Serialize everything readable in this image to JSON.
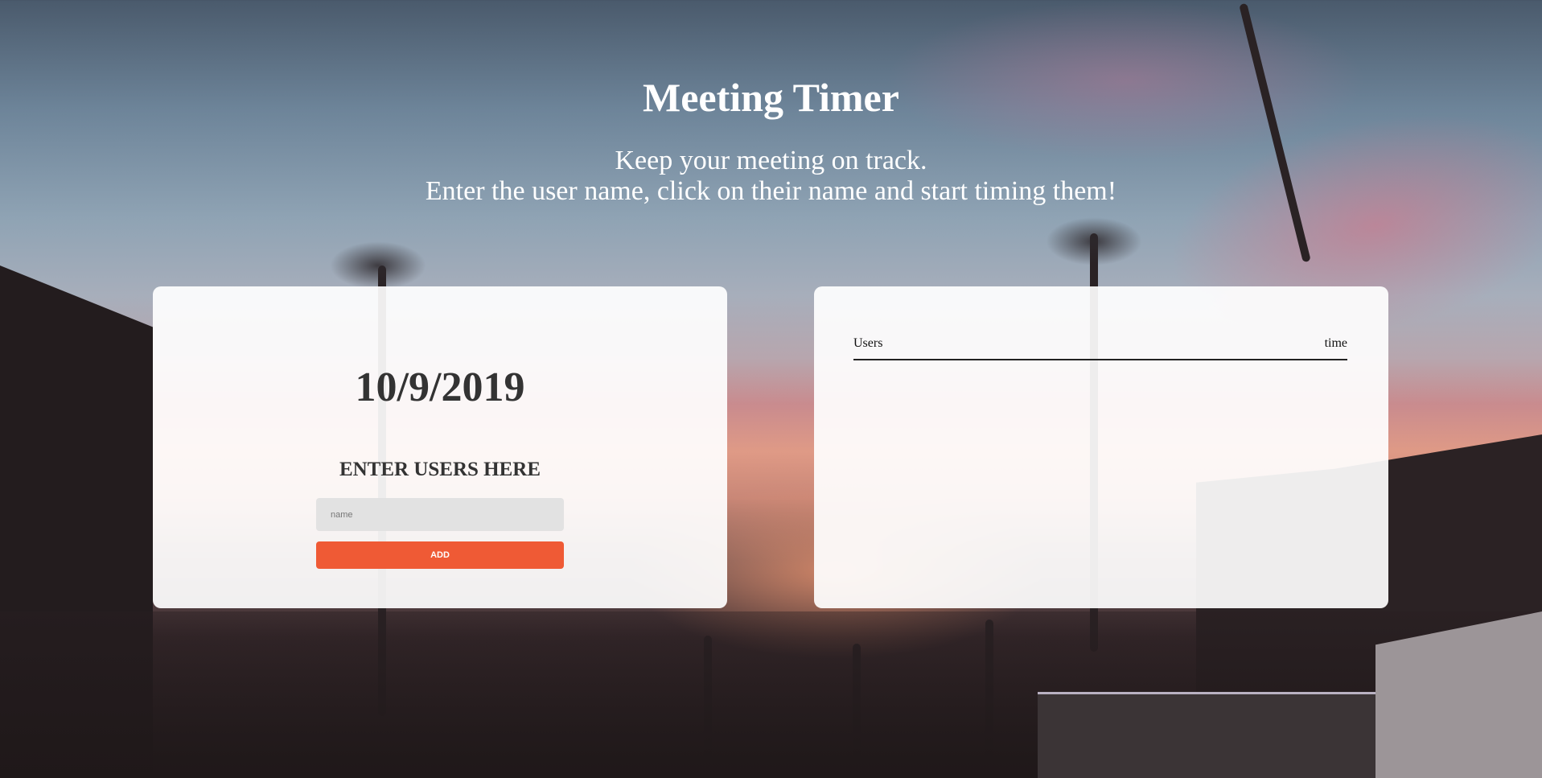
{
  "header": {
    "title": "Meeting Timer",
    "subtitle_line1": "Keep your meeting on track.",
    "subtitle_line2": "Enter the user name, click on their name and start timing them!"
  },
  "entry_panel": {
    "date": "10/9/2019",
    "heading": "ENTER USERS HERE",
    "name_placeholder": "name",
    "add_label": "ADD"
  },
  "users_panel": {
    "columns": [
      "Users",
      "time"
    ],
    "rows": []
  },
  "colors": {
    "accent": "#ef5a35",
    "card_background": "#ffffff",
    "heading_text": "#333333",
    "title_text": "#ffffff"
  }
}
